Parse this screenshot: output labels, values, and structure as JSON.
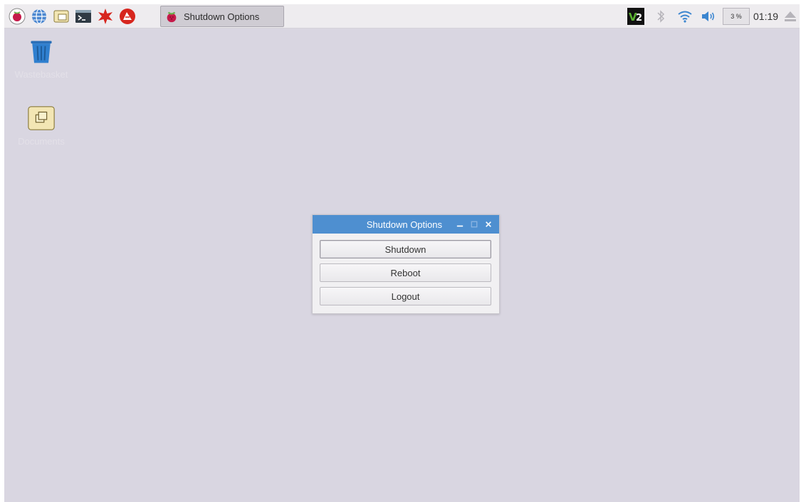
{
  "taskbar": {
    "launchers": [
      {
        "name": "raspberry-menu-icon"
      },
      {
        "name": "web-browser-icon"
      },
      {
        "name": "file-manager-icon"
      },
      {
        "name": "terminal-icon"
      },
      {
        "name": "mathematica-icon"
      },
      {
        "name": "wolfram-icon"
      }
    ],
    "task": {
      "label": "Shutdown Options",
      "icon": "raspberry-icon"
    },
    "tray": {
      "vnc_label": "V2",
      "cpu_label": "3 %",
      "clock": "01:19"
    }
  },
  "desktop": {
    "icons": [
      {
        "label": "Wastebasket",
        "icon": "trash-icon"
      },
      {
        "label": "Documents",
        "icon": "folder-icon"
      }
    ]
  },
  "dialog": {
    "title": "Shutdown Options",
    "buttons": {
      "shutdown": "Shutdown",
      "reboot": "Reboot",
      "logout": "Logout"
    }
  },
  "colors": {
    "desktop": "#d9d6e1",
    "titlebar": "#4e8fd0",
    "taskbar": "#eeecef"
  }
}
